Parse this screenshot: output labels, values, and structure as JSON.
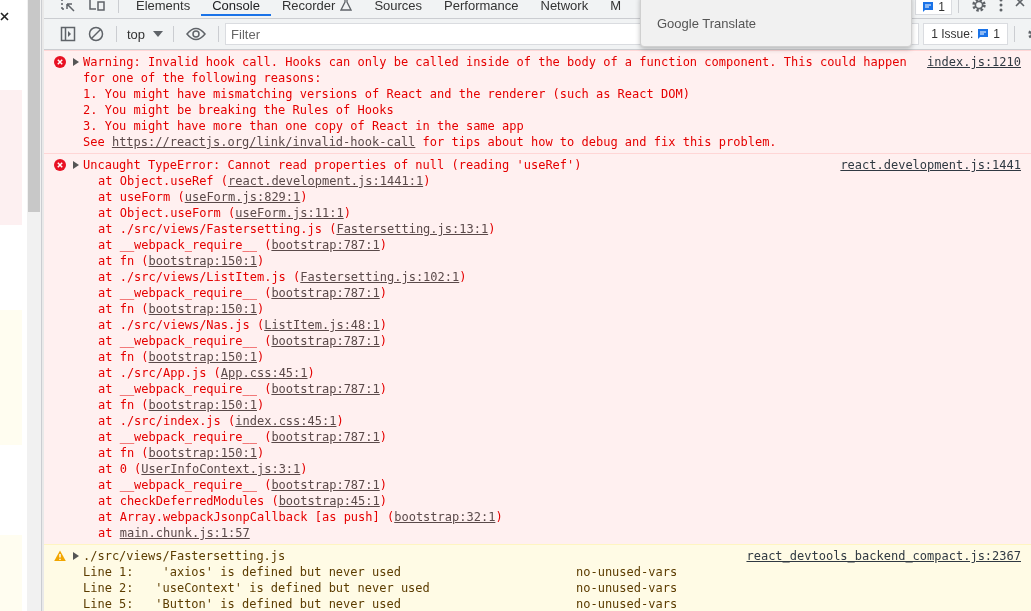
{
  "tabs": [
    {
      "label": "Elements",
      "kind": "plain",
      "selected": false
    },
    {
      "label": "Console",
      "kind": "plain",
      "selected": true
    },
    {
      "label": "Recorder",
      "kind": "experiment",
      "selected": false
    },
    {
      "label": "Sources",
      "kind": "plain",
      "selected": false
    },
    {
      "label": "Performance",
      "kind": "plain",
      "selected": false
    },
    {
      "label": "Network",
      "kind": "plain",
      "selected": false
    },
    {
      "label": "M",
      "kind": "plain",
      "selected": false
    }
  ],
  "messages_badge": "1",
  "toolbar": {
    "context": "top",
    "filter": {
      "placeholder": "Filter"
    },
    "issues": {
      "label": "1 Issue:",
      "count": "1"
    }
  },
  "translate_popup": {
    "title": "Google Translate"
  },
  "messages": [
    {
      "kind": "error",
      "expanded": false,
      "source": "index.js:1210",
      "lines": [
        [
          {
            "text": "Warning: Invalid hook call. Hooks can only be called inside of the body of a function component. This could happen",
            "link": false
          }
        ],
        [
          {
            "text": "for one of the following reasons:",
            "link": false
          }
        ],
        [
          {
            "text": "1. You might have mismatching versions of React and the renderer (such as React DOM)",
            "link": false
          }
        ],
        [
          {
            "text": "2. You might be breaking the Rules of Hooks",
            "link": false
          }
        ],
        [
          {
            "text": "3. You might have more than one copy of React in the same app",
            "link": false
          }
        ],
        [
          {
            "text": "See ",
            "link": false
          },
          {
            "text": "https://reactjs.org/link/invalid-hook-call",
            "link": true
          },
          {
            "text": " for tips about how to debug and fix this problem.",
            "link": false
          }
        ]
      ]
    },
    {
      "kind": "error",
      "expanded": false,
      "source": "react.development.js:1441",
      "lines": [
        [
          {
            "text": "Uncaught TypeError: Cannot read properties of null (reading 'useRef')",
            "link": false
          }
        ]
      ],
      "frames": [
        [
          {
            "text": "at Object.useRef (",
            "link": false
          },
          {
            "text": "react.development.js:1441:1",
            "link": true
          },
          {
            "text": ")",
            "link": false
          }
        ],
        [
          {
            "text": "at useForm (",
            "link": false
          },
          {
            "text": "useForm.js:829:1",
            "link": true
          },
          {
            "text": ")",
            "link": false
          }
        ],
        [
          {
            "text": "at Object.useForm (",
            "link": false
          },
          {
            "text": "useForm.js:11:1",
            "link": true
          },
          {
            "text": ")",
            "link": false
          }
        ],
        [
          {
            "text": "at ./src/views/Fastersetting.js (",
            "link": false
          },
          {
            "text": "Fastersetting.js:13:1",
            "link": true
          },
          {
            "text": ")",
            "link": false
          }
        ],
        [
          {
            "text": "at __webpack_require__ (",
            "link": false
          },
          {
            "text": "bootstrap:787:1",
            "link": true
          },
          {
            "text": ")",
            "link": false
          }
        ],
        [
          {
            "text": "at fn (",
            "link": false
          },
          {
            "text": "bootstrap:150:1",
            "link": true
          },
          {
            "text": ")",
            "link": false
          }
        ],
        [
          {
            "text": "at ./src/views/ListItem.js (",
            "link": false
          },
          {
            "text": "Fastersetting.js:102:1",
            "link": true
          },
          {
            "text": ")",
            "link": false
          }
        ],
        [
          {
            "text": "at __webpack_require__ (",
            "link": false
          },
          {
            "text": "bootstrap:787:1",
            "link": true
          },
          {
            "text": ")",
            "link": false
          }
        ],
        [
          {
            "text": "at fn (",
            "link": false
          },
          {
            "text": "bootstrap:150:1",
            "link": true
          },
          {
            "text": ")",
            "link": false
          }
        ],
        [
          {
            "text": "at ./src/views/Nas.js (",
            "link": false
          },
          {
            "text": "ListItem.js:48:1",
            "link": true
          },
          {
            "text": ")",
            "link": false
          }
        ],
        [
          {
            "text": "at __webpack_require__ (",
            "link": false
          },
          {
            "text": "bootstrap:787:1",
            "link": true
          },
          {
            "text": ")",
            "link": false
          }
        ],
        [
          {
            "text": "at fn (",
            "link": false
          },
          {
            "text": "bootstrap:150:1",
            "link": true
          },
          {
            "text": ")",
            "link": false
          }
        ],
        [
          {
            "text": "at ./src/App.js (",
            "link": false
          },
          {
            "text": "App.css:45:1",
            "link": true
          },
          {
            "text": ")",
            "link": false
          }
        ],
        [
          {
            "text": "at __webpack_require__ (",
            "link": false
          },
          {
            "text": "bootstrap:787:1",
            "link": true
          },
          {
            "text": ")",
            "link": false
          }
        ],
        [
          {
            "text": "at fn (",
            "link": false
          },
          {
            "text": "bootstrap:150:1",
            "link": true
          },
          {
            "text": ")",
            "link": false
          }
        ],
        [
          {
            "text": "at ./src/index.js (",
            "link": false
          },
          {
            "text": "index.css:45:1",
            "link": true
          },
          {
            "text": ")",
            "link": false
          }
        ],
        [
          {
            "text": "at __webpack_require__ (",
            "link": false
          },
          {
            "text": "bootstrap:787:1",
            "link": true
          },
          {
            "text": ")",
            "link": false
          }
        ],
        [
          {
            "text": "at fn (",
            "link": false
          },
          {
            "text": "bootstrap:150:1",
            "link": true
          },
          {
            "text": ")",
            "link": false
          }
        ],
        [
          {
            "text": "at 0 (",
            "link": false
          },
          {
            "text": "UserInfoContext.js:3:1",
            "link": true
          },
          {
            "text": ")",
            "link": false
          }
        ],
        [
          {
            "text": "at __webpack_require__ (",
            "link": false
          },
          {
            "text": "bootstrap:787:1",
            "link": true
          },
          {
            "text": ")",
            "link": false
          }
        ],
        [
          {
            "text": "at checkDeferredModules (",
            "link": false
          },
          {
            "text": "bootstrap:45:1",
            "link": true
          },
          {
            "text": ")",
            "link": false
          }
        ],
        [
          {
            "text": "at Array.webpackJsonpCallback [as push] (",
            "link": false
          },
          {
            "text": "bootstrap:32:1",
            "link": true
          },
          {
            "text": ")",
            "link": false
          }
        ],
        [
          {
            "text": "at ",
            "link": false
          },
          {
            "text": "main.chunk.js:1:57",
            "link": true
          }
        ]
      ]
    },
    {
      "kind": "warning",
      "expanded": false,
      "source": "react_devtools_backend_compact.js:2367",
      "lines": [
        [
          {
            "text": "./src/views/Fastersetting.js",
            "link": false
          }
        ]
      ],
      "lint": [
        {
          "text": "Line 1:    'axios' is defined but never used",
          "rule": "no-unused-vars"
        },
        {
          "text": "Line 2:   'useContext' is defined but never used",
          "rule": "no-unused-vars"
        },
        {
          "text": "Line 5:   'Button' is defined but never used",
          "rule": "no-unused-vars"
        }
      ]
    }
  ]
}
